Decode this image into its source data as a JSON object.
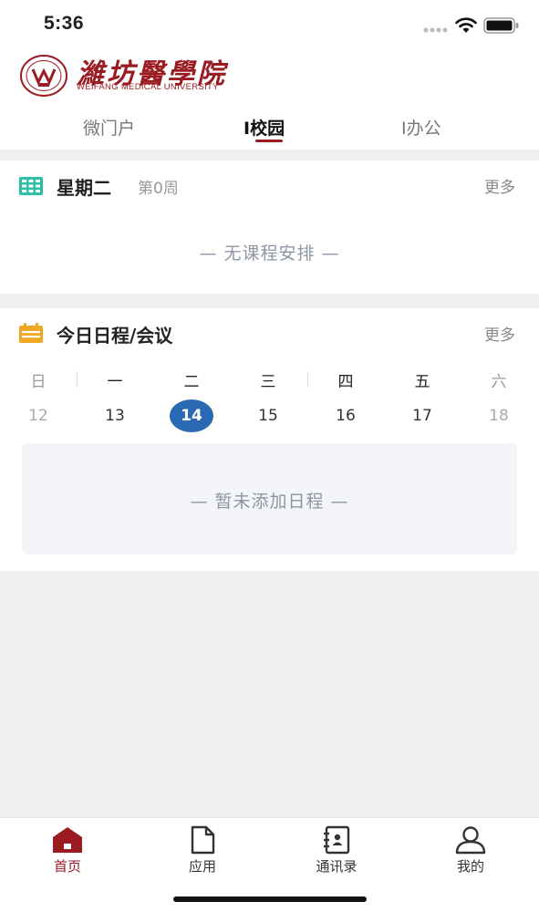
{
  "status_bar": {
    "time": "5:36"
  },
  "header": {
    "logo_cn": "濰坊醫學院",
    "logo_en": "WEIFANG MEDICAL UNIVERSITY",
    "tabs": [
      {
        "label": "微门户",
        "active": false
      },
      {
        "label": "I校园",
        "active": true
      },
      {
        "label": "I办公",
        "active": false
      }
    ]
  },
  "course_card": {
    "title": "星期二",
    "subtitle": "第0周",
    "more": "更多",
    "empty_text": "— 无课程安排 —",
    "icon": "table-icon",
    "icon_color": "#2bbfa6"
  },
  "schedule_card": {
    "title": "今日日程/会议",
    "more": "更多",
    "icon": "calendar-icon",
    "icon_color": "#f0a824",
    "weekdays": [
      "日",
      "一",
      "二",
      "三",
      "四",
      "五",
      "六"
    ],
    "dates": [
      "12",
      "13",
      "14",
      "15",
      "16",
      "17",
      "18"
    ],
    "selected_date": "14",
    "empty_text": "— 暂未添加日程 —"
  },
  "tabbar": {
    "items": [
      {
        "label": "首页",
        "icon": "home-icon",
        "active": true
      },
      {
        "label": "应用",
        "icon": "file-icon",
        "active": false
      },
      {
        "label": "通讯录",
        "icon": "contacts-icon",
        "active": false
      },
      {
        "label": "我的",
        "icon": "user-icon",
        "active": false
      }
    ]
  },
  "colors": {
    "brand": "#9b1b23",
    "accent_blue": "#2a6ab5"
  }
}
